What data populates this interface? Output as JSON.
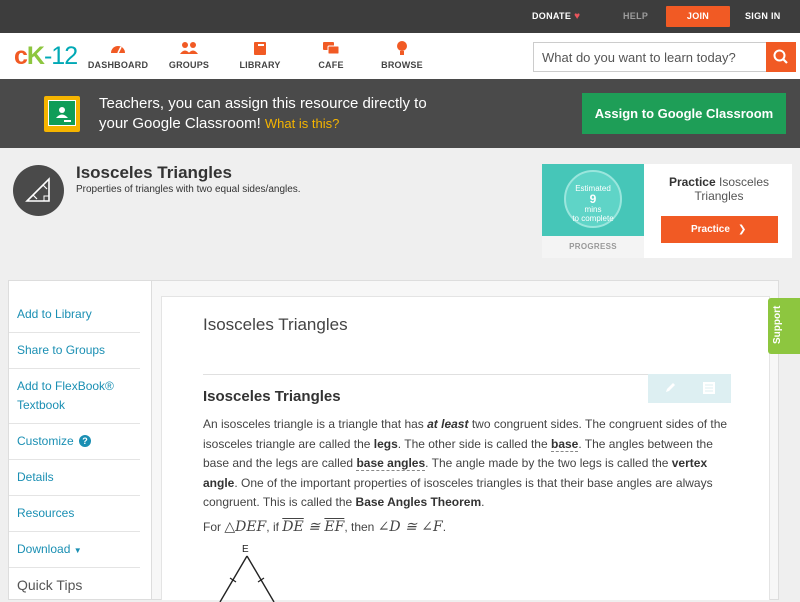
{
  "topbar": {
    "donate": "DONATE",
    "help": "HELP",
    "join": "JOIN",
    "signin": "SIGN IN"
  },
  "logo": {
    "c": "c",
    "k": "K",
    "dash": "-",
    "num": "12"
  },
  "nav": {
    "items": [
      {
        "label": "DASHBOARD",
        "icon": "dashboard-icon"
      },
      {
        "label": "GROUPS",
        "icon": "groups-icon"
      },
      {
        "label": "LIBRARY",
        "icon": "library-icon"
      },
      {
        "label": "CAFE",
        "icon": "cafe-icon"
      },
      {
        "label": "BROWSE",
        "icon": "browse-icon"
      }
    ],
    "search_placeholder": "What do you want to learn today?"
  },
  "banner": {
    "line1": "Teachers, you can assign this resource directly to",
    "line2": "your Google Classroom!",
    "what": "What is this?",
    "assign": "Assign to Google Classroom"
  },
  "concept": {
    "title": "Isosceles Triangles",
    "subtitle": "Properties of triangles with two equal sides/angles."
  },
  "practice": {
    "estimated": "Estimated",
    "mins": "9",
    "mins_label": "mins",
    "to_complete": "to complete",
    "progress": "PROGRESS",
    "title_bold": "Practice",
    "title_rest": "Isosceles Triangles",
    "button": "Practice"
  },
  "sidebar": {
    "items": [
      "Add to Library",
      "Share to Groups",
      "Add to FlexBook® Textbook",
      "Customize",
      "Details",
      "Resources",
      "Download"
    ],
    "download_arrow": "▼",
    "quick_tips": "Quick Tips"
  },
  "content": {
    "title": "Isosceles Triangles",
    "heading": "Isosceles Triangles",
    "p_a": "An isosceles triangle is a triangle that has ",
    "p_atleast": "at least",
    "p_b": " two congruent sides. The congruent sides of the isosceles triangle are called the ",
    "p_legs": "legs",
    "p_c": ". The other side is called the ",
    "p_base": "base",
    "p_d": ". The angles between the base and the legs are called ",
    "p_baseangles": "base angles",
    "p_e": ". The angle made by the two legs is called the ",
    "p_vertex": "vertex angle",
    "p_f": ". One of the important properties of isosceles triangles is that their base angles are always congruent. This is called the ",
    "p_theorem": "Base Angles Theorem",
    "p_g": ".",
    "math_for": "For ",
    "math_tri": "△DEF",
    "math_if": ", if ",
    "math_de": "DE",
    "math_cong1": " ≅ ",
    "math_ef": "EF",
    "math_then": ", then ",
    "math_angles": "∠D ≅ ∠F",
    "math_end": ".",
    "vertex_label": "E"
  },
  "support": "Support"
}
